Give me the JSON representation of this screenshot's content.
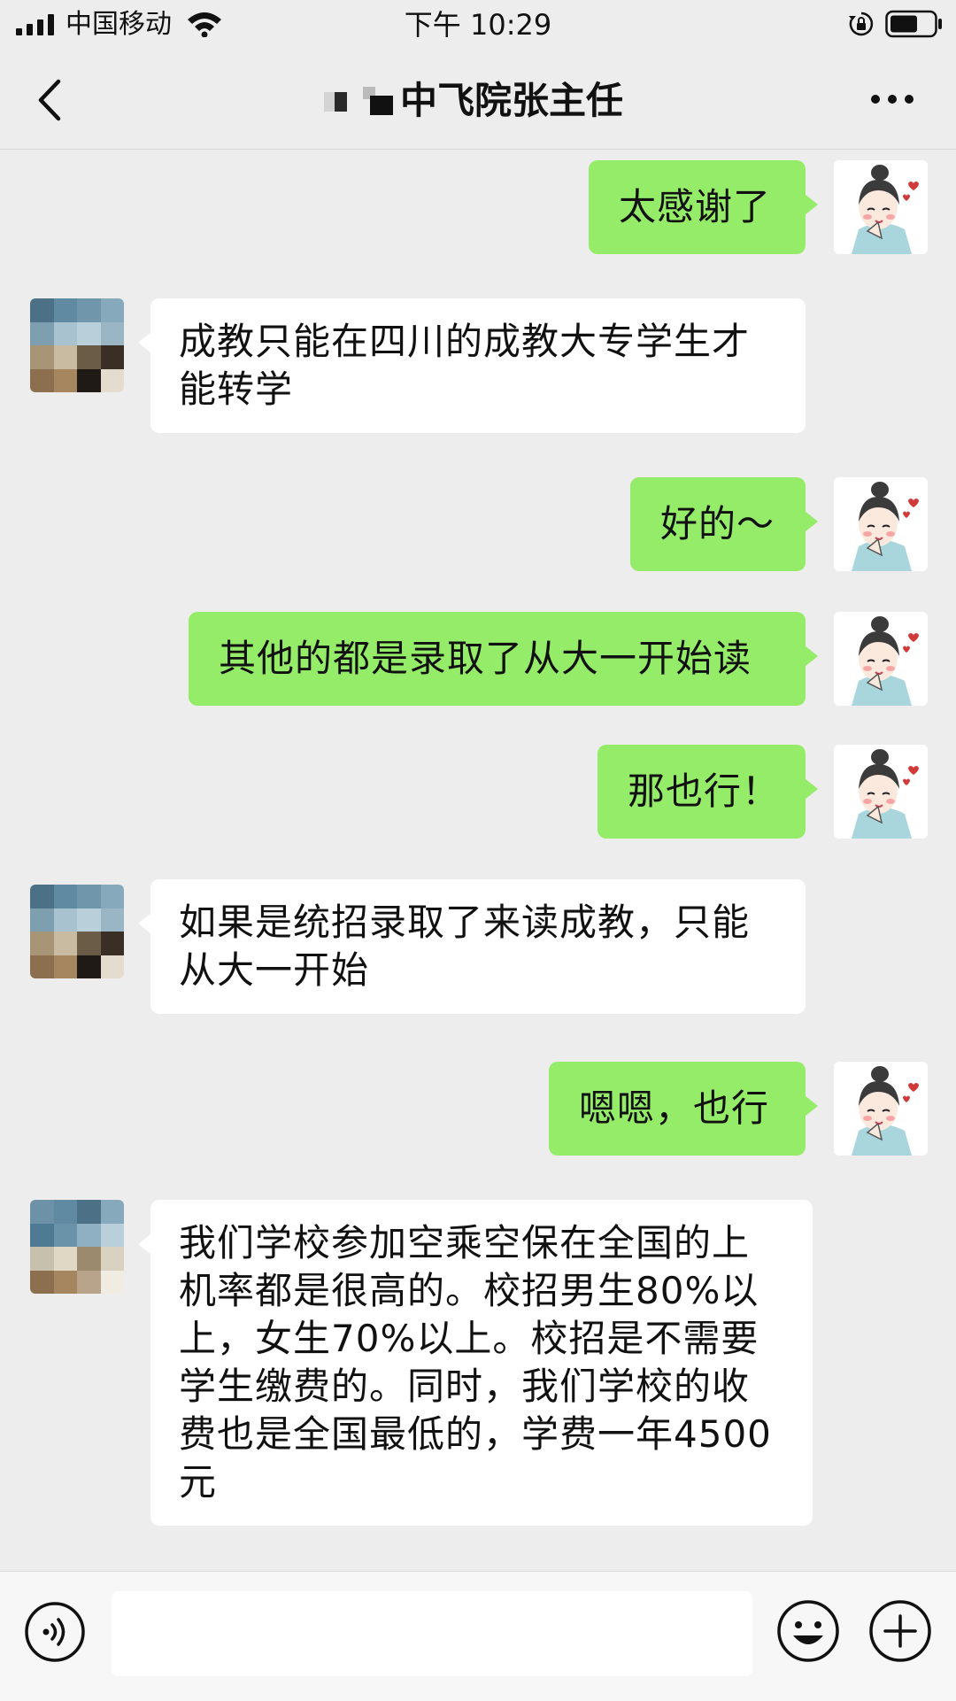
{
  "status_bar": {
    "carrier": "中国移动",
    "time": "下午 10:29",
    "icons": [
      "signal-icon",
      "wifi-icon",
      "rotation-lock-icon",
      "battery-icon"
    ]
  },
  "header": {
    "title": "中飞院张主任",
    "back_icon": "chevron-left-icon",
    "more_icon": "more-dots-icon"
  },
  "messages": [
    {
      "direction": "out",
      "text": "太感谢了"
    },
    {
      "direction": "in",
      "text": "成教只能在四川的成教大专学生才能转学"
    },
    {
      "direction": "out",
      "text": "好的～"
    },
    {
      "direction": "out",
      "text": "其他的都是录取了从大一开始读"
    },
    {
      "direction": "out",
      "text": "那也行！"
    },
    {
      "direction": "in",
      "text": "如果是统招录取了来读成教，只能从大一开始"
    },
    {
      "direction": "out",
      "text": "嗯嗯，也行"
    },
    {
      "direction": "in",
      "text": "我们学校参加空乘空保在全国的上机率都是很高的。校招男生80%以上，女生70%以上。校招是不需要学生缴费的。同时，我们学校的收费也是全国最低的，学费一年4500元"
    }
  ],
  "input_bar": {
    "text_value": "",
    "icons": [
      "voice-icon",
      "emoji-icon",
      "plus-icon"
    ]
  },
  "colors": {
    "background": "#ededed",
    "outgoing_bubble": "#95ec69",
    "incoming_bubble": "#ffffff",
    "input_bar": "#f7f7f7"
  }
}
